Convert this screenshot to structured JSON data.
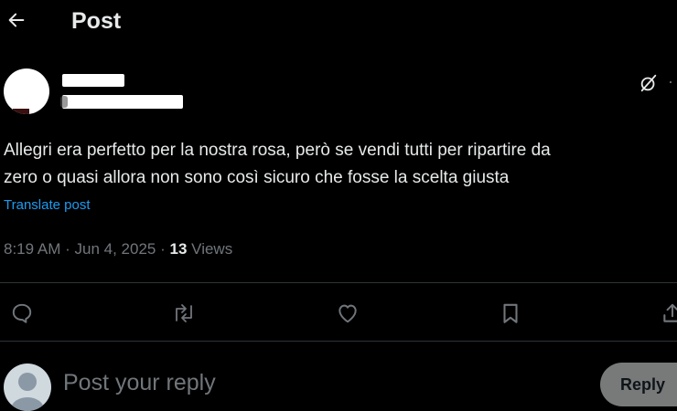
{
  "header": {
    "title": "Post",
    "back_icon": "arrow-left-icon"
  },
  "post": {
    "text": "Allegri era perfetto per la nostra rosa, però se vendi tutti per ripartire da\nzero o quasi allora non sono così sicuro che fosse la scelta giusta",
    "translate_label": "Translate post",
    "time": "8:19 AM",
    "sep": "·",
    "date": "Jun 4, 2025",
    "views_count": "13",
    "views_label": "Views"
  },
  "actions": [
    "reply-icon",
    "repost-icon",
    "like-icon",
    "bookmark-icon",
    "share-icon"
  ],
  "composer": {
    "placeholder": "Post your reply",
    "reply_button": "Reply"
  },
  "colors": {
    "background": "#000000",
    "text": "#e7e9ea",
    "muted": "#71767b",
    "link": "#1d9bf0",
    "divider": "#2f3336",
    "button": "#787a7a"
  }
}
